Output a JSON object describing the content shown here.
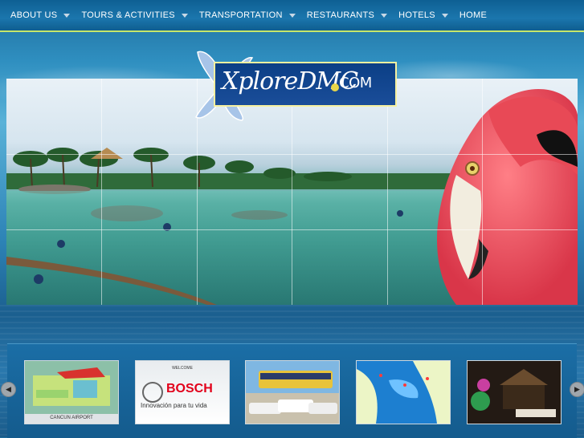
{
  "nav": {
    "items": [
      {
        "label": "ABOUT US",
        "has_dropdown": true
      },
      {
        "label": "TOURS & ACTIVITIES",
        "has_dropdown": true
      },
      {
        "label": "TRANSPORTATION",
        "has_dropdown": true
      },
      {
        "label": "RESTAURANTS",
        "has_dropdown": true
      },
      {
        "label": "HOTELS",
        "has_dropdown": true
      },
      {
        "label": "HOME",
        "has_dropdown": false
      }
    ]
  },
  "logo": {
    "brand": "XploreDMC",
    "suffix": "COM"
  },
  "carousel": {
    "prev_icon": "chevron-left-icon",
    "next_icon": "chevron-right-icon",
    "items": [
      {
        "name": "airport-map",
        "caption": "CANCUN AIRPORT"
      },
      {
        "name": "bosch-banner",
        "welcome": "WELCOME",
        "brand": "BOSCH",
        "tagline": "Innovación para tu vida"
      },
      {
        "name": "transport-photo"
      },
      {
        "name": "region-map"
      },
      {
        "name": "restaurant-photo"
      }
    ]
  },
  "colors": {
    "nav_bg": "#1b76ad",
    "nav_border": "#c7e66a",
    "logo_blue": "#0b3f86",
    "bosch_red": "#e2001a"
  }
}
